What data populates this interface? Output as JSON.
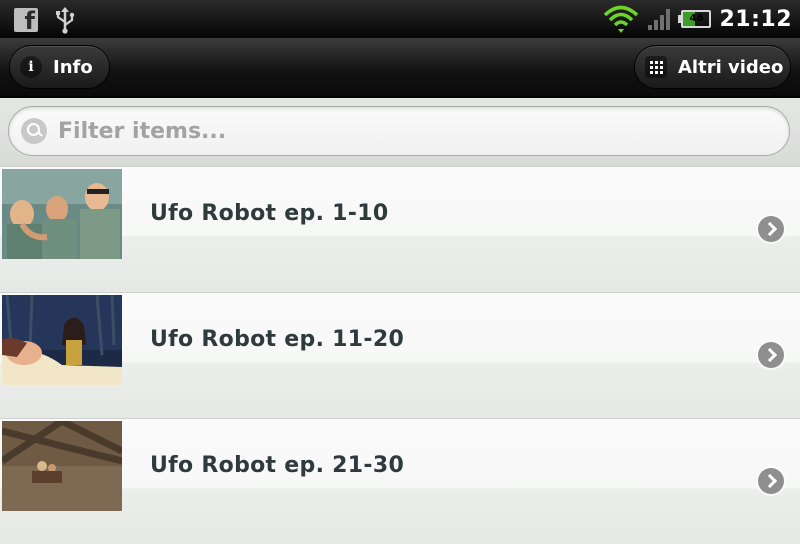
{
  "status_bar": {
    "battery_level": "46",
    "time": "21:12",
    "icons": [
      "facebook-icon",
      "usb-icon",
      "wifi-icon",
      "signal-icon",
      "battery-icon"
    ]
  },
  "header": {
    "info_label": "Info",
    "more_label": "Altri video"
  },
  "filter": {
    "placeholder": "Filter items..."
  },
  "list": {
    "items": [
      {
        "title": "Ufo Robot ep. 1-10"
      },
      {
        "title": "Ufo Robot ep. 11-20"
      },
      {
        "title": "Ufo Robot ep. 21-30"
      }
    ]
  }
}
